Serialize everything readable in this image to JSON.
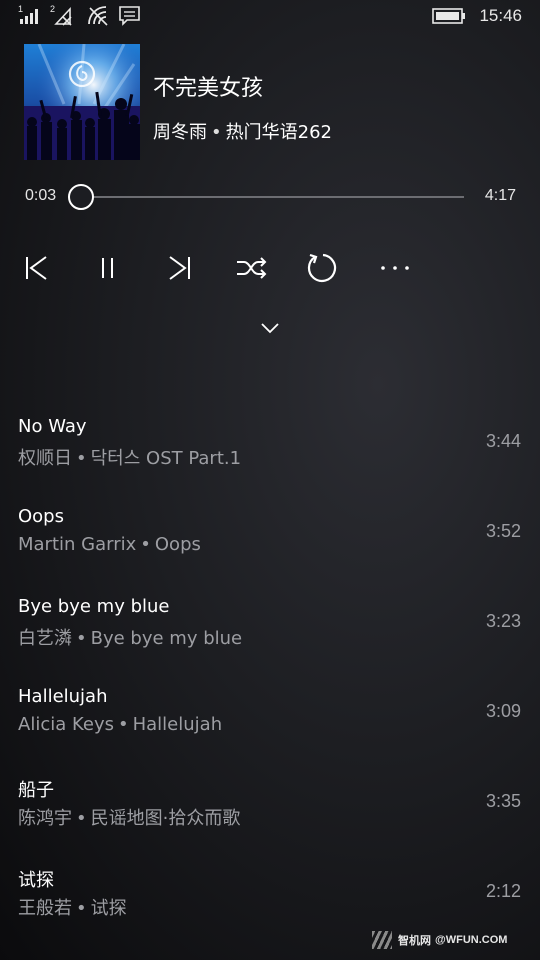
{
  "status_bar": {
    "sim1_label": "1",
    "sim2_label": "2",
    "time": "15:46",
    "icons": [
      "signal-bars-icon",
      "signal-bars-crossed-icon",
      "wifi-icon",
      "message-icon",
      "battery-icon"
    ]
  },
  "now_playing": {
    "title": "不完美女孩",
    "artist": "周冬雨",
    "album": "热门华语262",
    "separator": "•",
    "album_art": "concert-crowd-image",
    "album_art_badge": "netease-music-logo-icon"
  },
  "progress": {
    "elapsed": "0:03",
    "total": "4:17",
    "fraction": 0.012
  },
  "controls": {
    "icons": [
      "previous-icon",
      "pause-icon",
      "next-icon",
      "shuffle-icon",
      "repeat-icon",
      "more-icon"
    ],
    "collapse_icon": "chevron-down-icon"
  },
  "playlist": [
    {
      "title": "No Way",
      "artist": "权顺日",
      "album": "닥터스 OST Part.1",
      "duration": "3:44"
    },
    {
      "title": "Oops",
      "artist": "Martin Garrix",
      "album": "Oops",
      "duration": "3:52"
    },
    {
      "title": "Bye bye my blue",
      "artist": "白艺潾",
      "album": "Bye bye my blue",
      "duration": "3:23"
    },
    {
      "title": "Hallelujah",
      "artist": "Alicia Keys",
      "album": "Hallelujah",
      "duration": "3:09"
    },
    {
      "title": "船子",
      "artist": "陈鸿宇",
      "album": "民谣地图·拾众而歌",
      "duration": "3:35"
    },
    {
      "title": "试探",
      "artist": "王般若",
      "album": "试探",
      "duration": "2:12"
    }
  ],
  "watermark": {
    "cn": "智机网",
    "site": "@WFUN.COM"
  },
  "colors": {
    "background": "#1d1e22",
    "primary_text": "#ffffff",
    "secondary_text": "#9d9ea3",
    "progress_track": "#6c6d72"
  }
}
